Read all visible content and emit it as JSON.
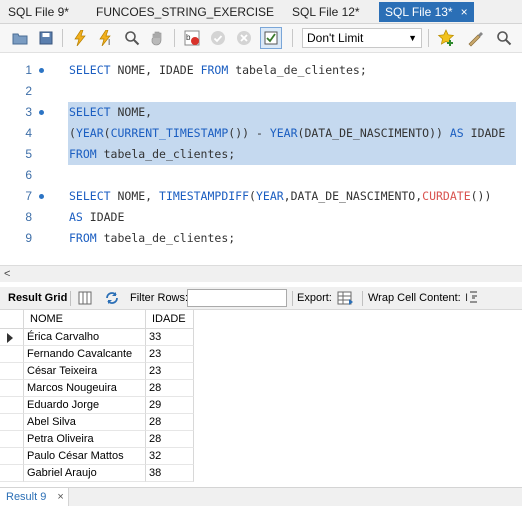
{
  "tabs": [
    {
      "label": "SQL File 9*",
      "active": false
    },
    {
      "label": "FUNCOES_STRING_EXERCISE",
      "active": false
    },
    {
      "label": "SQL File 12*",
      "active": false
    },
    {
      "label": "SQL File 13*",
      "active": true,
      "close": "×"
    }
  ],
  "toolbar": {
    "limit_value": "Don't Limit"
  },
  "editor": {
    "lines": [
      {
        "num": "1",
        "marker": true,
        "tokens": [
          [
            "kw",
            "SELECT"
          ],
          [
            "pl",
            " NOME, IDADE "
          ],
          [
            "kw",
            "FROM"
          ],
          [
            "pl",
            " tabela_de_clientes;"
          ]
        ]
      },
      {
        "num": "2",
        "marker": false,
        "tokens": []
      },
      {
        "num": "3",
        "marker": true,
        "highlight": true,
        "tokens": [
          [
            "kw",
            "SELECT"
          ],
          [
            "pl",
            " NOME,"
          ]
        ]
      },
      {
        "num": "4",
        "marker": false,
        "highlight": true,
        "tokens": [
          [
            "pl",
            "("
          ],
          [
            "fn",
            "YEAR"
          ],
          [
            "pl",
            "("
          ],
          [
            "fn",
            "CURRENT_TIMESTAMP"
          ],
          [
            "pl",
            "()) - "
          ],
          [
            "fn",
            "YEAR"
          ],
          [
            "pl",
            "(DATA_DE_NASCIMENTO)) "
          ],
          [
            "kw",
            "AS"
          ],
          [
            "pl",
            " IDADE"
          ]
        ]
      },
      {
        "num": "5",
        "marker": false,
        "highlight": true,
        "tokens": [
          [
            "kw",
            "FROM"
          ],
          [
            "pl",
            " tabela_de_clientes;"
          ]
        ]
      },
      {
        "num": "6",
        "marker": false,
        "tokens": []
      },
      {
        "num": "7",
        "marker": true,
        "tokens": [
          [
            "kw",
            "SELECT"
          ],
          [
            "pl",
            " NOME, "
          ],
          [
            "fn",
            "TIMESTAMPDIFF"
          ],
          [
            "pl",
            "("
          ],
          [
            "fn",
            "YEAR"
          ],
          [
            "pl",
            ",DATA_DE_NASCIMENTO,"
          ],
          [
            "curd",
            "CURDATE"
          ],
          [
            "pl",
            "())"
          ]
        ]
      },
      {
        "num": "8",
        "marker": false,
        "tokens": [
          [
            "kw",
            "AS"
          ],
          [
            "pl",
            " IDADE"
          ]
        ]
      },
      {
        "num": "9",
        "marker": false,
        "tokens": [
          [
            "kw",
            "FROM"
          ],
          [
            "pl",
            " tabela_de_clientes;"
          ]
        ]
      }
    ]
  },
  "result_toolbar": {
    "result_grid": "Result Grid",
    "filter_rows": "Filter Rows:",
    "filter_value": "",
    "export": "Export:",
    "wrap_cell": "Wrap Cell Content:"
  },
  "grid": {
    "columns": [
      "NOME",
      "IDADE"
    ],
    "rows": [
      [
        "Érica Carvalho",
        "33"
      ],
      [
        "Fernando Cavalcante",
        "23"
      ],
      [
        "César Teixeira",
        "23"
      ],
      [
        "Marcos Nougeuira",
        "28"
      ],
      [
        "Eduardo Jorge",
        "29"
      ],
      [
        "Abel Silva",
        "28"
      ],
      [
        "Petra Oliveira",
        "28"
      ],
      [
        "Paulo César Mattos",
        "32"
      ],
      [
        "Gabriel Araujo",
        "38"
      ]
    ]
  },
  "bottom_tab": {
    "label": "Result 9",
    "close": "×"
  },
  "colors": {
    "accent": "#2b6fb6",
    "keyword": "#1b5ec1",
    "selection": "#c5d9ef"
  }
}
